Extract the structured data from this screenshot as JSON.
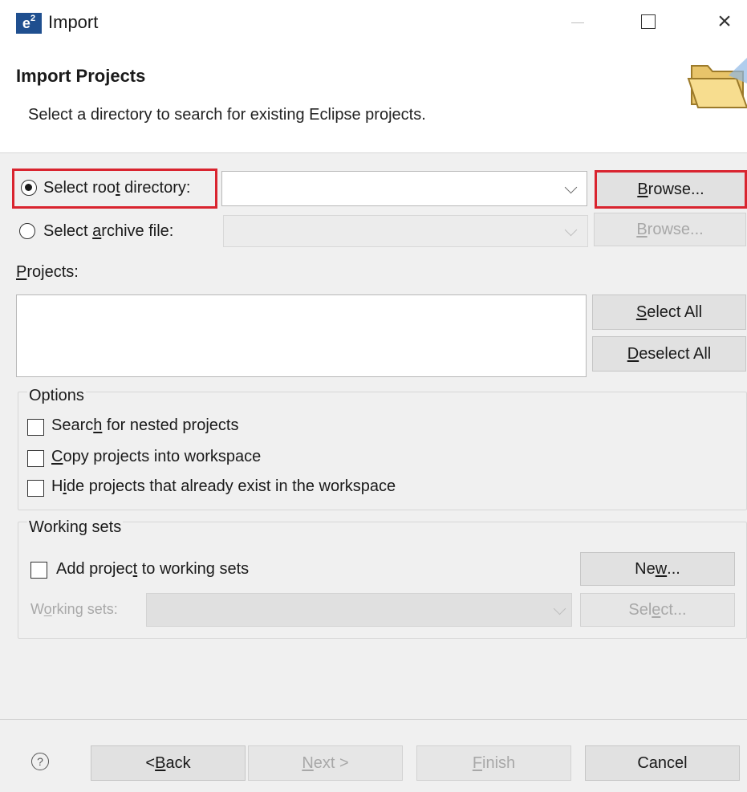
{
  "window": {
    "icon_label": "e",
    "icon_sup": "2",
    "title": "Import",
    "minimize_glyph": "—",
    "maximize_glyph": "☐",
    "close_glyph": "×"
  },
  "header": {
    "title": "Import Projects",
    "description": "Select a directory to search for existing Eclipse projects.",
    "icon": "folder-icon"
  },
  "source": {
    "root": {
      "label_pre": "Select roo",
      "label_u": "t",
      "label_post": " directory:",
      "selected": true,
      "value": ""
    },
    "archive": {
      "label_pre": "Select ",
      "label_u": "a",
      "label_post": "rchive file:",
      "selected": false,
      "value": ""
    },
    "browse_root": {
      "u": "B",
      "rest": "rowse..."
    },
    "browse_archive": {
      "u": "B",
      "rest": "rowse..."
    }
  },
  "projects": {
    "label_u": "P",
    "label_rest": "rojects:",
    "items": [],
    "select_all": {
      "u": "S",
      "rest": "elect All"
    },
    "deselect_all": {
      "u": "D",
      "rest": "eselect All"
    }
  },
  "options": {
    "title": "Options",
    "items": [
      {
        "pre": "Searc",
        "u": "h",
        "post": " for nested projects",
        "checked": false
      },
      {
        "pre": "",
        "u": "C",
        "post": "opy projects into workspace",
        "checked": false
      },
      {
        "pre": "H",
        "u": "i",
        "post": "de projects that already exist in the workspace",
        "checked": false
      }
    ]
  },
  "working_sets": {
    "title": "Working sets",
    "add": {
      "pre": "Add projec",
      "u": "t",
      "post": " to working sets",
      "checked": false
    },
    "new_button": {
      "pre": "Ne",
      "u": "w",
      "post": "..."
    },
    "label": {
      "pre": "W",
      "u": "o",
      "post": "rking sets:"
    },
    "select_button": {
      "pre": "Sel",
      "u": "e",
      "post": "ct..."
    }
  },
  "footer": {
    "help": "?",
    "back": {
      "pre": "< ",
      "u": "B",
      "post": "ack"
    },
    "next": {
      "pre": "",
      "u": "N",
      "post": "ext >"
    },
    "finish": {
      "pre": "",
      "u": "F",
      "post": "inish"
    },
    "cancel": "Cancel"
  },
  "colors": {
    "highlight_border": "#d9242f",
    "dialog_bg": "#f0f0f0",
    "banner_bg": "#ffffff",
    "button_bg": "#e1e1e1",
    "disabled_text": "#a8a8a8"
  }
}
